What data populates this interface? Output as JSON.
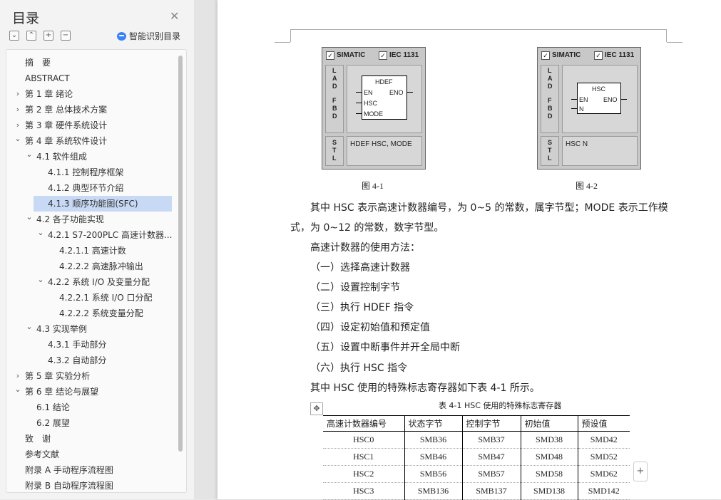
{
  "sidebar": {
    "title": "目录",
    "ai_label": "智能识别目录",
    "toc": [
      {
        "label": "摘　要",
        "level": 0,
        "chevron": ""
      },
      {
        "label": "ABSTRACT",
        "level": 0,
        "chevron": ""
      },
      {
        "label": "第 1 章  绪论",
        "level": 0,
        "chevron": ">"
      },
      {
        "label": "第 2 章  总体技术方案",
        "level": 0,
        "chevron": ">"
      },
      {
        "label": "第 3 章  硬件系统设计",
        "level": 0,
        "chevron": ">"
      },
      {
        "label": "第 4 章  系统软件设计",
        "level": 0,
        "chevron": "v"
      },
      {
        "label": "4.1 软件组成",
        "level": 1,
        "chevron": "v"
      },
      {
        "label": "4.1.1 控制程序框架",
        "level": 2,
        "chevron": ""
      },
      {
        "label": "4.1.2 典型环节介绍",
        "level": 2,
        "chevron": ""
      },
      {
        "label": "4.1.3 顺序功能图(SFC)",
        "level": 2,
        "chevron": "",
        "selected": true
      },
      {
        "label": "4.2 各子功能实现",
        "level": 1,
        "chevron": "v"
      },
      {
        "label": "4.2.1 S7-200PLC 高速计数器...",
        "level": 2,
        "chevron": "v"
      },
      {
        "label": "4.2.1.1 高速计数",
        "level": 3,
        "chevron": ""
      },
      {
        "label": "4.2.2.2 高速脉冲输出",
        "level": 3,
        "chevron": ""
      },
      {
        "label": "4.2.2 系统 I/O 及变量分配",
        "level": 2,
        "chevron": "v"
      },
      {
        "label": "4.2.2.1 系统 I/O 口分配",
        "level": 3,
        "chevron": ""
      },
      {
        "label": "4.2.2.2 系统变量分配",
        "level": 3,
        "chevron": ""
      },
      {
        "label": "4.3 实现举例",
        "level": 1,
        "chevron": "v"
      },
      {
        "label": "4.3.1 手动部分",
        "level": 2,
        "chevron": ""
      },
      {
        "label": "4.3.2 自动部分",
        "level": 2,
        "chevron": ""
      },
      {
        "label": "第 5 章  实验分析",
        "level": 0,
        "chevron": ">"
      },
      {
        "label": "第 6 章  结论与展望",
        "level": 0,
        "chevron": "v"
      },
      {
        "label": "6.1 结论",
        "level": 1,
        "chevron": ""
      },
      {
        "label": "6.2 展望",
        "level": 1,
        "chevron": ""
      },
      {
        "label": "致　谢",
        "level": 0,
        "chevron": ""
      },
      {
        "label": "参考文献",
        "level": 0,
        "chevron": ""
      },
      {
        "label": "附录 A  手动程序流程图",
        "level": 0,
        "chevron": ""
      },
      {
        "label": "附录 B  自动程序流程图",
        "level": 0,
        "chevron": ""
      }
    ]
  },
  "figures": [
    {
      "simatic": "SIMATIC",
      "iec": "IEC 1131",
      "block_title": "HDEF",
      "pin_en": "EN",
      "pin_eno": "ENO",
      "pin_2": "HSC",
      "pin_3": "MODE",
      "stl": "HDEF   HSC, MODE",
      "caption": "图 4-1"
    },
    {
      "simatic": "SIMATIC",
      "iec": "IEC 1131",
      "block_title": "HSC",
      "pin_en": "EN",
      "pin_eno": "ENO",
      "pin_2": "N",
      "stl": "HSC     N",
      "caption": "图 4-2"
    }
  ],
  "doc": {
    "p1a": "其中 HSC 表示高速计数器编号，为 0~5 的常数，属字节型；MODE 表示工作模",
    "p1b": "式，为 0~12 的常数，数字节型。",
    "p2": "高速计数器的使用方法：",
    "steps": [
      "（一）选择高速计数器",
      "（二）设置控制字节",
      "（三）执行 HDEF 指令",
      "（四）设定初始值和预定值",
      "（五）设置中断事件并开全局中断",
      "（六）执行 HSC 指令"
    ],
    "p3": "其中 HSC 使用的特殊标志寄存器如下表 4-1 所示。",
    "table_caption": "表 4-1    HSC 使用的特殊标志寄存器",
    "table_headers": [
      "高速计数器编号",
      "状态字节",
      "控制字节",
      "初始值",
      "预设值"
    ],
    "table_rows": [
      [
        "HSC0",
        "SMB36",
        "SMB37",
        "SMD38",
        "SMD42"
      ],
      [
        "HSC1",
        "SMB46",
        "SMB47",
        "SMD48",
        "SMD52"
      ],
      [
        "HSC2",
        "SMB56",
        "SMB57",
        "SMD58",
        "SMD62"
      ],
      [
        "HSC3",
        "SMB136",
        "SMB137",
        "SMD138",
        "SMD142"
      ]
    ]
  }
}
